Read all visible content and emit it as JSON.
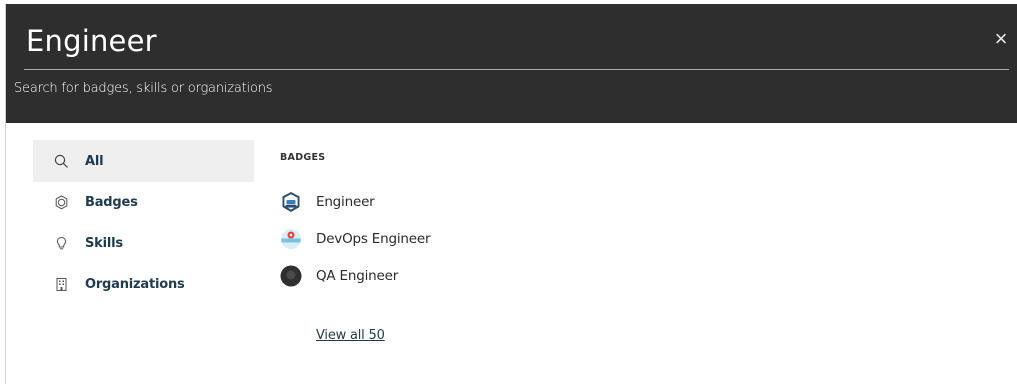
{
  "search": {
    "query": "Engineer",
    "hint": "Search for badges, skills or organizations",
    "close_symbol": "×"
  },
  "sidebar": {
    "items": [
      {
        "label": "All",
        "icon": "search-icon",
        "active": true
      },
      {
        "label": "Badges",
        "icon": "badge-icon",
        "active": false
      },
      {
        "label": "Skills",
        "icon": "lightbulb-icon",
        "active": false
      },
      {
        "label": "Organizations",
        "icon": "building-icon",
        "active": false
      }
    ]
  },
  "results": {
    "section_title": "BADGES",
    "badges": [
      {
        "name": "Engineer",
        "icon": "engineer-badge-icon"
      },
      {
        "name": "DevOps Engineer",
        "icon": "devops-badge-icon"
      },
      {
        "name": "QA Engineer",
        "icon": "qa-badge-icon"
      }
    ],
    "view_all": "View all 50"
  },
  "colors": {
    "header_bg": "#2e2e2e",
    "active_bg": "#efefef",
    "accent_text": "#1f3b4d"
  }
}
